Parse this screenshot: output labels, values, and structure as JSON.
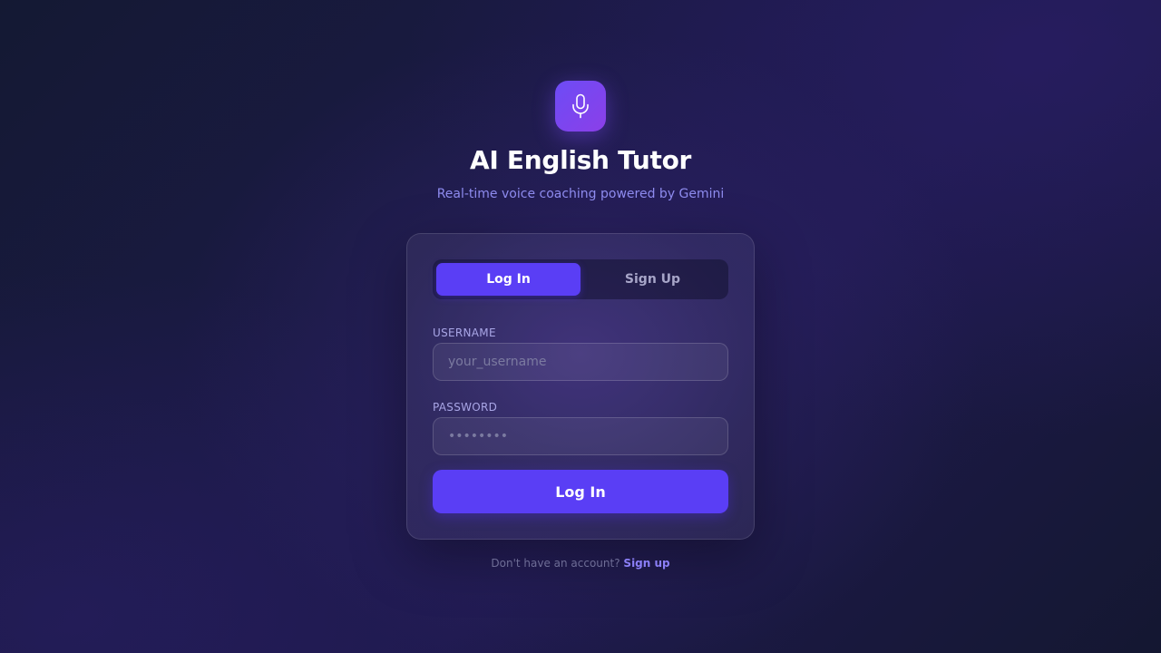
{
  "app": {
    "title": "AI English Tutor",
    "subtitle": "Real-time voice coaching powered by Gemini",
    "logo_icon": "microphone-icon"
  },
  "auth_tabs": {
    "items": [
      {
        "label": "Log In",
        "active": true
      },
      {
        "label": "Sign Up",
        "active": false
      }
    ]
  },
  "form": {
    "username": {
      "label": "USERNAME",
      "placeholder": "your_username",
      "value": ""
    },
    "password": {
      "label": "PASSWORD",
      "placeholder": "••••••••",
      "value": ""
    },
    "submit_label": "Log In"
  },
  "footer": {
    "prompt": "Don't have an account?",
    "link_label": "Sign up"
  },
  "colors": {
    "accent": "#5a3ef5",
    "logo_gradient_start": "#6d4cf6",
    "logo_gradient_end": "#8b3fe8",
    "subtitle": "#8f8cf0",
    "background": "#1c1a48"
  }
}
